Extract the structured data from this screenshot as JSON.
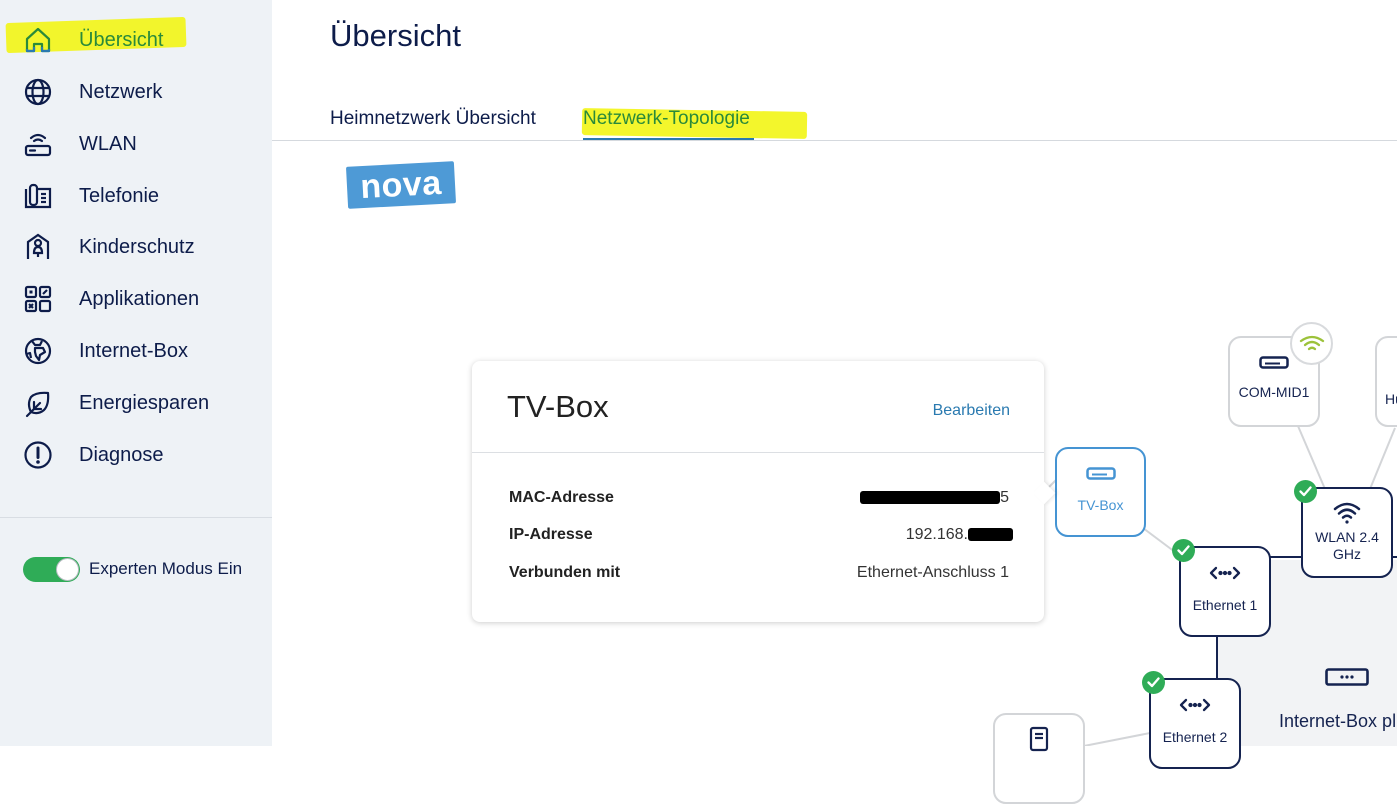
{
  "sidebar": {
    "items": [
      {
        "label": "Übersicht",
        "icon": "home-icon",
        "active": true
      },
      {
        "label": "Netzwerk",
        "icon": "globe-icon"
      },
      {
        "label": "WLAN",
        "icon": "router-wifi-icon"
      },
      {
        "label": "Telefonie",
        "icon": "phone-icon"
      },
      {
        "label": "Kinderschutz",
        "icon": "child-protection-icon"
      },
      {
        "label": "Applikationen",
        "icon": "apps-icon"
      },
      {
        "label": "Internet-Box",
        "icon": "earth-icon"
      },
      {
        "label": "Energiesparen",
        "icon": "leaf-icon"
      },
      {
        "label": "Diagnose",
        "icon": "alert-circle-icon"
      }
    ],
    "expert_mode": {
      "label": "Experten Modus Ein",
      "enabled": true
    }
  },
  "header": {
    "title": "Übersicht"
  },
  "tabs": [
    {
      "label": "Heimnetzwerk Übersicht",
      "active": false
    },
    {
      "label": "Netzwerk-Topologie",
      "active": true
    }
  ],
  "logo": {
    "text": "nova"
  },
  "colors": {
    "accent_blue": "#2a7ab0",
    "navy": "#0d1c4a",
    "success_green": "#2fac57",
    "highlight_yellow": "#f2f51a"
  },
  "popup": {
    "title": "TV-Box",
    "edit_label": "Bearbeiten",
    "rows": [
      {
        "key": "MAC-Adresse",
        "value": "[redacted]"
      },
      {
        "key": "IP-Adresse",
        "value": "192.168."
      },
      {
        "key": "Verbunden mit",
        "value": "Ethernet-Anschluss 1"
      }
    ]
  },
  "topology": {
    "nodes": {
      "tv_box": {
        "label": "TV-Box",
        "icon": "set-top-box-icon"
      },
      "com_mid1": {
        "label": "COM-MID1",
        "icon": "set-top-box-icon",
        "connection": "wifi"
      },
      "hu_device": {
        "label": "Hu"
      },
      "wlan24": {
        "label": "WLAN 2.4 GHz",
        "line1": "WLAN 2.4",
        "line2": "GHz",
        "icon": "wifi-icon",
        "status": "ok"
      },
      "ethernet1": {
        "label": "Ethernet 1",
        "icon": "ethernet-icon",
        "status": "ok"
      },
      "ethernet2": {
        "label": "Ethernet 2",
        "icon": "ethernet-icon",
        "status": "ok"
      },
      "internet_box": {
        "label": "Internet-Box pl",
        "icon": "internet-box-icon"
      },
      "pc_device": {
        "label": "",
        "icon": "computer-tower-icon"
      }
    }
  }
}
